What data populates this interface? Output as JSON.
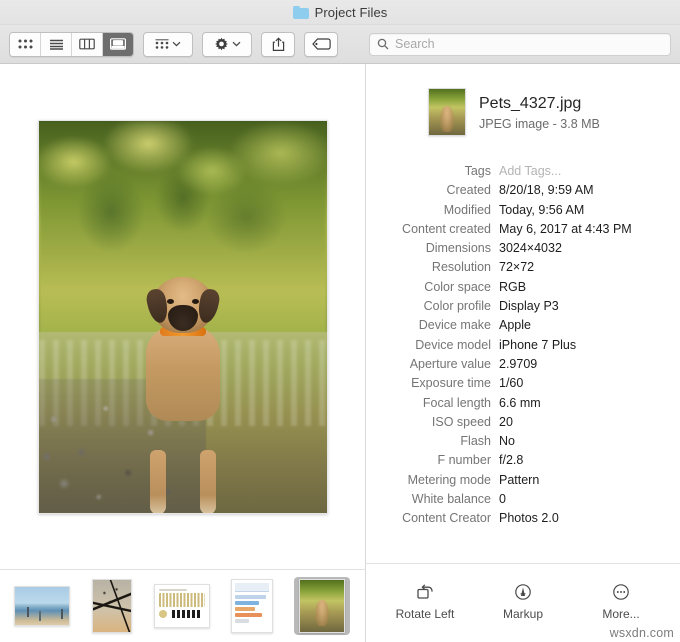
{
  "window": {
    "title": "Project Files",
    "folder_icon": "folder-icon"
  },
  "toolbar": {
    "view_modes": [
      {
        "name": "icon-view",
        "icon": "grid-icon",
        "active": false
      },
      {
        "name": "list-view",
        "icon": "list-icon",
        "active": false
      },
      {
        "name": "column-view",
        "icon": "columns-icon",
        "active": false
      },
      {
        "name": "gallery-view",
        "icon": "gallery-icon",
        "active": true
      }
    ],
    "group_button": {
      "icon": "group-icon",
      "chevron": "chevron-down-icon"
    },
    "action_button": {
      "icon": "gear-icon",
      "chevron": "chevron-down-icon"
    },
    "share_button": {
      "icon": "share-icon"
    },
    "tag_button": {
      "icon": "tag-icon"
    },
    "search": {
      "icon": "search-icon",
      "placeholder": "Search",
      "value": ""
    }
  },
  "preview": {
    "alt": "Dog standing in a river with green foliage"
  },
  "filmstrip": {
    "items": [
      {
        "name": "thumbnail-beach",
        "kind": "landscape",
        "selected": false
      },
      {
        "name": "thumbnail-flowers",
        "kind": "portrait",
        "selected": false
      },
      {
        "name": "thumbnail-document",
        "kind": "doc",
        "selected": false
      },
      {
        "name": "thumbnail-spreadsheet",
        "kind": "sheet",
        "selected": false
      },
      {
        "name": "thumbnail-pets",
        "kind": "sel",
        "selected": true
      }
    ]
  },
  "inspector": {
    "file_name": "Pets_4327.jpg",
    "file_subtitle": "JPEG image - 3.8 MB",
    "metadata": [
      {
        "label": "Tags",
        "value": "Add Tags...",
        "placeholder": true
      },
      {
        "label": "Created",
        "value": "8/20/18, 9:59 AM",
        "placeholder": false
      },
      {
        "label": "Modified",
        "value": "Today, 9:56 AM",
        "placeholder": false
      },
      {
        "label": "Content created",
        "value": "May 6, 2017 at 4:43 PM",
        "placeholder": false
      },
      {
        "label": "Dimensions",
        "value": "3024×4032",
        "placeholder": false
      },
      {
        "label": "Resolution",
        "value": "72×72",
        "placeholder": false
      },
      {
        "label": "Color space",
        "value": "RGB",
        "placeholder": false
      },
      {
        "label": "Color profile",
        "value": "Display P3",
        "placeholder": false
      },
      {
        "label": "Device make",
        "value": "Apple",
        "placeholder": false
      },
      {
        "label": "Device model",
        "value": "iPhone 7 Plus",
        "placeholder": false
      },
      {
        "label": "Aperture value",
        "value": "2.9709",
        "placeholder": false
      },
      {
        "label": "Exposure time",
        "value": "1/60",
        "placeholder": false
      },
      {
        "label": "Focal length",
        "value": "6.6 mm",
        "placeholder": false
      },
      {
        "label": "ISO speed",
        "value": "20",
        "placeholder": false
      },
      {
        "label": "Flash",
        "value": "No",
        "placeholder": false
      },
      {
        "label": "F number",
        "value": "f/2.8",
        "placeholder": false
      },
      {
        "label": "Metering mode",
        "value": "Pattern",
        "placeholder": false
      },
      {
        "label": "White balance",
        "value": "0",
        "placeholder": false
      },
      {
        "label": "Content Creator",
        "value": "Photos 2.0",
        "placeholder": false
      }
    ],
    "actions": [
      {
        "label": "Rotate Left",
        "icon": "rotate-left-icon"
      },
      {
        "label": "Markup",
        "icon": "markup-icon"
      },
      {
        "label": "More...",
        "icon": "more-icon"
      }
    ]
  },
  "watermark": "wsxdn.com",
  "colors": {
    "selection": "#b9b9b9",
    "folder_blue": "#8fcdef",
    "active_segment": "#6e6e6e"
  }
}
